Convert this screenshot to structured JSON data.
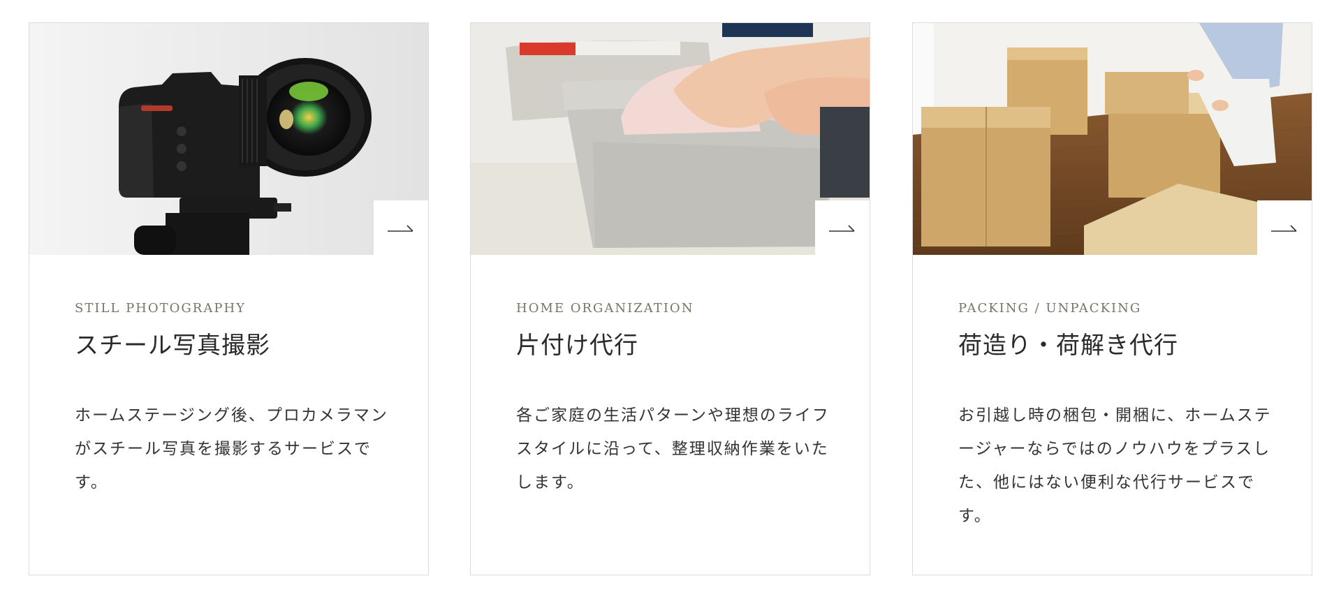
{
  "services": [
    {
      "eyebrow": "STILL PHOTOGRAPHY",
      "title": "スチール写真撮影",
      "description": "ホームステージング後、プロカメラマンがスチール写真を撮影するサービスです。",
      "image": "camera-on-tripod"
    },
    {
      "eyebrow": "HOME ORGANIZATION",
      "title": "片付け代行",
      "description": "各ご家庭の生活パターンや理想のライフスタイルに沿って、整理収納作業をいたします。",
      "image": "folding-clothes-in-felt-basket"
    },
    {
      "eyebrow": "PACKING / UNPACKING",
      "title": "荷造り・荷解き代行",
      "description": "お引越し時の梱包・開梱に、ホームステージャーならではのノウハウをプラスした、他にはない便利な代行サービスです。",
      "image": "cardboard-boxes-moving"
    }
  ],
  "icons": {
    "link_arrow": "arrow-right-icon"
  },
  "colors": {
    "eyebrow": "#7a7466",
    "title": "#2a2a2a",
    "text": "#333333",
    "border": "#dcdcdc"
  }
}
